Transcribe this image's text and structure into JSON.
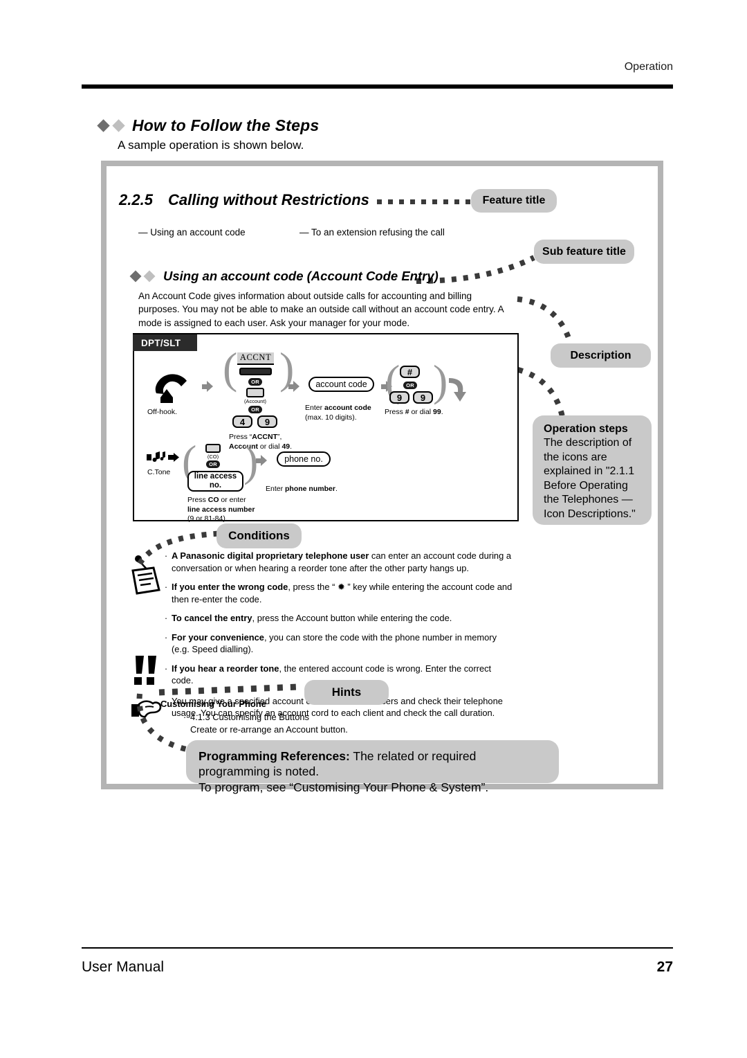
{
  "header": {
    "running_head": "Operation"
  },
  "section": {
    "title": "How to Follow the Steps",
    "subtitle": "A sample operation is shown below."
  },
  "feature": {
    "number": "2.2.5",
    "title": "Calling without Restrictions",
    "dash_items": [
      "— Using an account code",
      "— To an extension refusing the call"
    ],
    "sub_title": "Using an account code (Account Code Entry)",
    "description": "An Account Code gives information about outside calls for accounting and billing purposes. You may not be able to make an outside call without an account code entry. A mode is assigned to each user. Ask your manager for your mode."
  },
  "callouts": {
    "feature_title": "Feature title",
    "sub_feature_title": "Sub feature title",
    "description": "Description",
    "operation_steps_title": "Operation steps",
    "operation_steps_body": "The description of the icons are explained in \"2.1.1 Before Operating the Telephones — Icon Descriptions.\"",
    "conditions": "Conditions",
    "hints": "Hints"
  },
  "ops": {
    "phone_type_tag": "DPT/SLT",
    "row1": {
      "step1_caption": "Off-hook.",
      "step2_lcd": "ACCNT",
      "step2_or1": "OR",
      "step2_account_label": "(Account)",
      "step2_or2": "OR",
      "step2_key_a": "4",
      "step2_key_b": "9",
      "step2_caption_line1_pre": "Press “",
      "step2_caption_accnt": "ACCNT",
      "step2_caption_line1_post": "”,",
      "step2_caption_line2_bold": "Account",
      "step2_caption_line2_rest": " or dial ",
      "step2_caption_line2_num": "49",
      "step3_box": "account code",
      "step3_caption_pre": "Enter ",
      "step3_caption_bold": "account code",
      "step3_caption_line2": "(max. 10 digits).",
      "step4_hash": "#",
      "step4_or": "OR",
      "step4_key_a": "9",
      "step4_key_b": "9",
      "step4_caption_pre": "Press ",
      "step4_caption_hash": "#",
      "step4_caption_mid": " or dial ",
      "step4_caption_num": "99",
      "step4_caption_end": "."
    },
    "row2": {
      "tone_caption": "C.Tone",
      "co_label": "(CO)",
      "or": "OR",
      "line_access": "line access\nno.",
      "caption_line1_pre": "Press ",
      "caption_line1_bold": "CO",
      "caption_line1_post": " or enter",
      "caption_line2": "line access number",
      "caption_line3": "(9 or 81-84).",
      "phone_no_box": "phone no.",
      "phone_caption_pre": "Enter ",
      "phone_caption_bold": "phone number",
      "phone_caption_end": "."
    }
  },
  "conditions_items": [
    {
      "bullet": "·",
      "bold": "A Panasonic digital proprietary telephone user",
      "rest": " can enter an account code during a conversation or when hearing a reorder tone after the other party hangs up."
    },
    {
      "bullet": "·",
      "bold": "If you enter the wrong code",
      "rest": ", press the “ ✹ ” key while entering the account code and then re-enter the code."
    },
    {
      "bullet": "·",
      "bold": "To cancel the entry",
      "rest": ", press the Account button while entering the code."
    },
    {
      "bullet": "·",
      "bold": "For your convenience",
      "rest": ", you can store the code with the phone number in memory (e.g. Speed dialling)."
    },
    {
      "bullet": "·",
      "bold": "If you hear a reorder tone",
      "rest": ", the entered account code is wrong.  Enter the correct code."
    },
    {
      "bullet": "·",
      "bold": "",
      "rest": "You may give a specified account cord to extension users and check their telephone usage. You can specify an account cord to each client and check the call duration."
    }
  ],
  "hints": {
    "title": "Customising Your Phone",
    "bullet": "·",
    "line1": "4.1.3   Customising the Buttons",
    "line2": "Create or re-arrange an Account button."
  },
  "programming": {
    "bold": "Programming References:",
    "rest": " The related or required programming is noted.",
    "line2": "To program, see “Customising Your Phone & System”."
  },
  "footer": {
    "left": "User Manual",
    "page": "27"
  }
}
